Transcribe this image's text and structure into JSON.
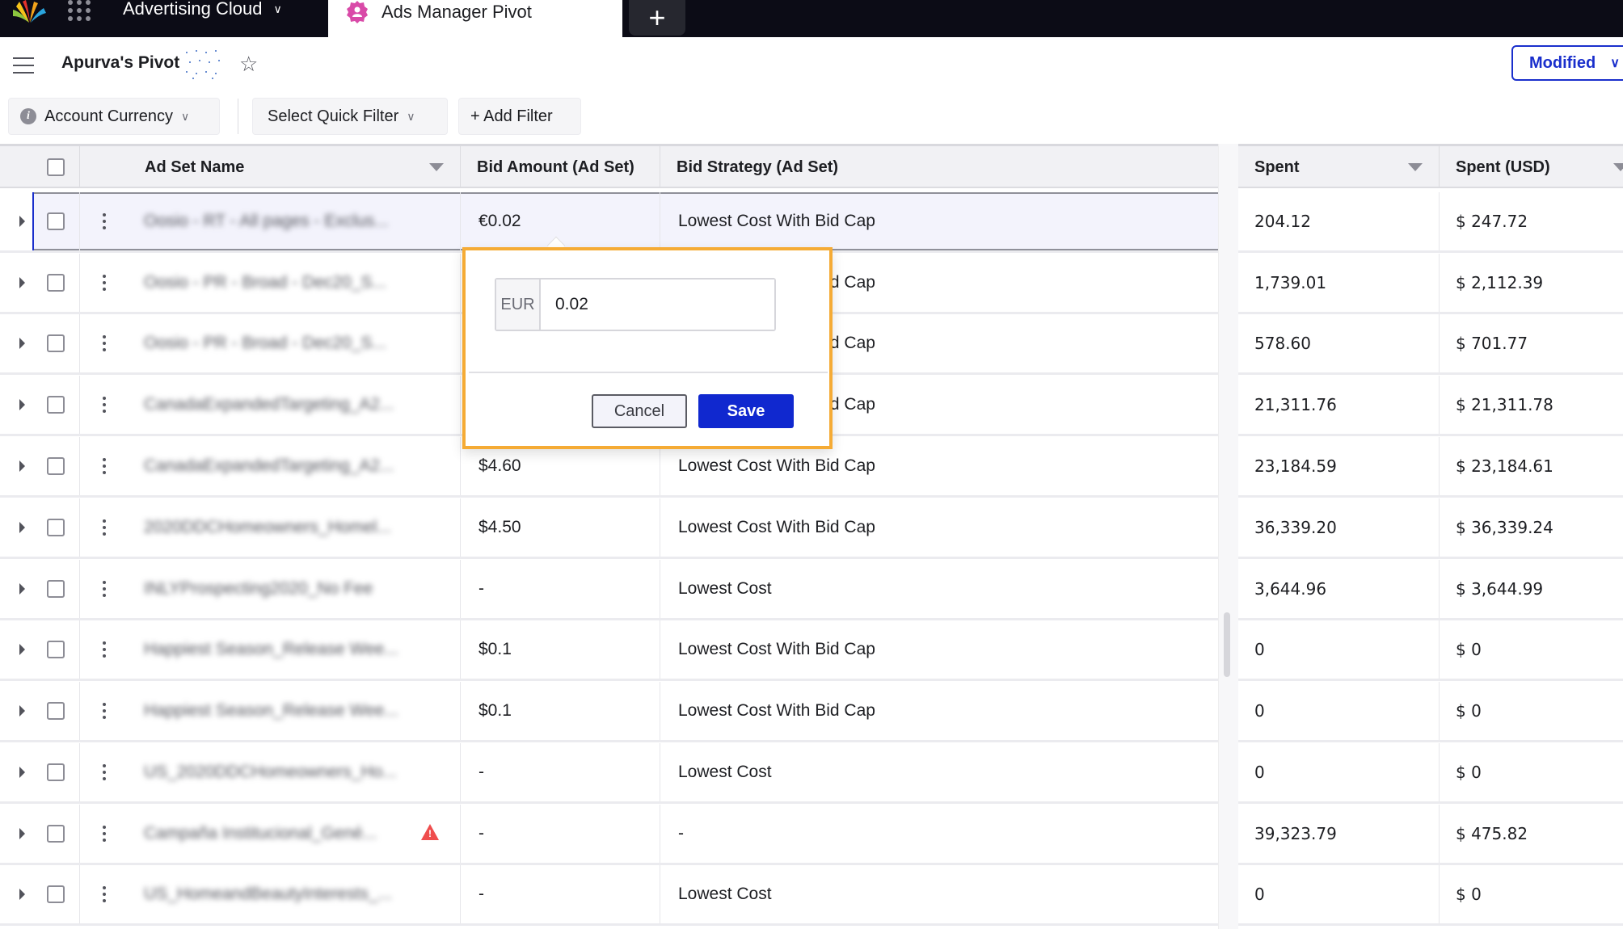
{
  "topbar": {
    "app_name": "Advertising Cloud",
    "active_tab_label": "Ads Manager Pivot",
    "new_tab_label": "+"
  },
  "subbar": {
    "pivot_title": "Apurva's Pivot",
    "status_button_label": "Modified"
  },
  "filters": {
    "account_currency_label": "Account Currency",
    "quick_filter_label": "Select Quick Filter",
    "add_filter_label": "+ Add Filter"
  },
  "table": {
    "columns": {
      "name": "Ad Set Name",
      "bid_amount": "Bid Amount (Ad Set)",
      "bid_strategy": "Bid Strategy (Ad Set)",
      "spent": "Spent",
      "spent_usd": "Spent (USD)"
    },
    "rows": [
      {
        "name": "Oosio - RT - All pages - Exclus...",
        "bid_amount": "€0.02",
        "bid_strategy": "Lowest Cost With Bid Cap",
        "spent": "204.12",
        "spent_usd": "$ 247.72",
        "warning": false,
        "selected": true
      },
      {
        "name": "Oosio - PR - Broad - Dec20_S...",
        "bid_amount": "",
        "bid_strategy": "Lowest Cost With Bid Cap",
        "spent": "1,739.01",
        "spent_usd": "$ 2,112.39",
        "warning": false,
        "selected": false
      },
      {
        "name": "Oosio - PR - Broad - Dec20_S...",
        "bid_amount": "",
        "bid_strategy": "Lowest Cost With Bid Cap",
        "spent": "578.60",
        "spent_usd": "$ 701.77",
        "warning": false,
        "selected": false
      },
      {
        "name": "CanadaExpandedTargeting_A2...",
        "bid_amount": "",
        "bid_strategy": "Lowest Cost With Bid Cap",
        "spent": "21,311.76",
        "spent_usd": "$ 21,311.78",
        "warning": false,
        "selected": false
      },
      {
        "name": "CanadaExpandedTargeting_A2...",
        "bid_amount": "$4.60",
        "bid_strategy": "Lowest Cost With Bid Cap",
        "spent": "23,184.59",
        "spent_usd": "$ 23,184.61",
        "warning": false,
        "selected": false
      },
      {
        "name": "2020DDCHomeowners_Homel...",
        "bid_amount": "$4.50",
        "bid_strategy": "Lowest Cost With Bid Cap",
        "spent": "36,339.20",
        "spent_usd": "$ 36,339.24",
        "warning": false,
        "selected": false
      },
      {
        "name": "INLYProspecting2020_No Fee",
        "bid_amount": "-",
        "bid_strategy": "Lowest Cost",
        "spent": "3,644.96",
        "spent_usd": "$ 3,644.99",
        "warning": false,
        "selected": false
      },
      {
        "name": "Happiest Season_Release Wee...",
        "bid_amount": "$0.1",
        "bid_strategy": "Lowest Cost With Bid Cap",
        "spent": "0",
        "spent_usd": "$ 0",
        "warning": false,
        "selected": false
      },
      {
        "name": "Happiest Season_Release Wee...",
        "bid_amount": "$0.1",
        "bid_strategy": "Lowest Cost With Bid Cap",
        "spent": "0",
        "spent_usd": "$ 0",
        "warning": false,
        "selected": false
      },
      {
        "name": "US_2020DDCHomeowners_Ho...",
        "bid_amount": "-",
        "bid_strategy": "Lowest Cost",
        "spent": "0",
        "spent_usd": "$ 0",
        "warning": false,
        "selected": false
      },
      {
        "name": "Campaña Institucional_Gené...",
        "bid_amount": "-",
        "bid_strategy": "-",
        "spent": "39,323.79",
        "spent_usd": "$ 475.82",
        "warning": true,
        "selected": false
      },
      {
        "name": "US_HomeandBeautyInterests_...",
        "bid_amount": "-",
        "bid_strategy": "Lowest Cost",
        "spent": "0",
        "spent_usd": "$ 0",
        "warning": false,
        "selected": false
      }
    ]
  },
  "popover": {
    "currency_prefix": "EUR",
    "value": "0.02",
    "cancel_label": "Cancel",
    "save_label": "Save",
    "highlight_color": "#f5ab35",
    "save_color": "#1028cf"
  },
  "icons": {
    "logo": "sprinklr-logo-icon",
    "app_grid": "grid-icon",
    "tab": "pivot-gear-icon",
    "menu": "hamburger-icon",
    "favorite": "star-icon",
    "info": "info-icon",
    "sort": "sort-down-icon",
    "expand": "expand-triangle-icon",
    "row_menu": "kebab-icon",
    "warning": "warning-icon"
  }
}
